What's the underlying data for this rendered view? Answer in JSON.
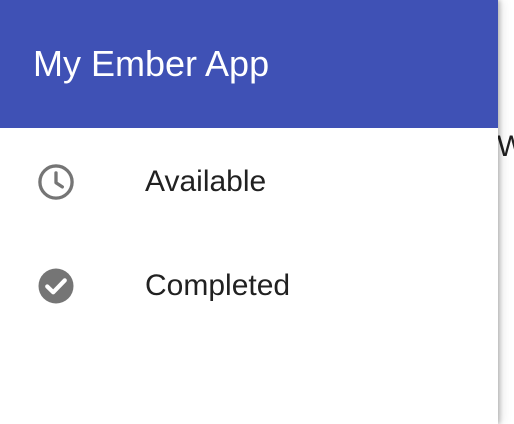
{
  "app": {
    "title": "My Ember App",
    "header_color": "#3f51b5"
  },
  "nav": {
    "items": [
      {
        "label": "Available",
        "icon": "clock-icon"
      },
      {
        "label": "Completed",
        "icon": "check-circle-icon"
      }
    ]
  },
  "background": {
    "partial_text": "W"
  }
}
